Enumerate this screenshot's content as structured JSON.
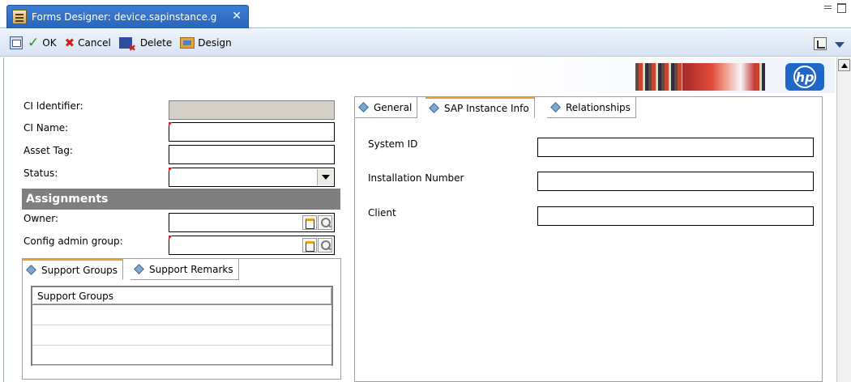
{
  "window": {
    "tab_title": "Forms Designer: device.sapinstance.g",
    "close_glyph": "✕"
  },
  "toolbar": {
    "ok_label": "OK",
    "cancel_label": "Cancel",
    "delete_label": "Delete",
    "design_label": "Design"
  },
  "form": {
    "ci_identifier_label": "CI Identifier:",
    "ci_name_label": "CI Name:",
    "asset_tag_label": "Asset Tag:",
    "status_label": "Status:",
    "ci_identifier_value": "",
    "ci_name_value": "",
    "asset_tag_value": "",
    "status_value": ""
  },
  "assignments": {
    "heading": "Assignments",
    "owner_label": "Owner:",
    "config_admin_group_label": "Config admin group:",
    "owner_value": "",
    "config_admin_group_value": ""
  },
  "left_tabs": {
    "tabs": [
      "Support Groups",
      "Support Remarks"
    ],
    "active": 0,
    "grid_header": "Support Groups",
    "rows": [
      "",
      "",
      ""
    ]
  },
  "right_tabs": {
    "tabs": [
      "General",
      "SAP Instance Info",
      "Relationships"
    ],
    "active": 1,
    "fields": [
      {
        "label": "System ID",
        "value": ""
      },
      {
        "label": "Installation Number",
        "value": ""
      },
      {
        "label": "Client",
        "value": ""
      }
    ]
  },
  "colors": {
    "tab_active_accent": "#e8a03a",
    "title_tab_blue": "#2a64b8",
    "section_bar": "#7f7f7f",
    "required_marker": "#e02020"
  }
}
